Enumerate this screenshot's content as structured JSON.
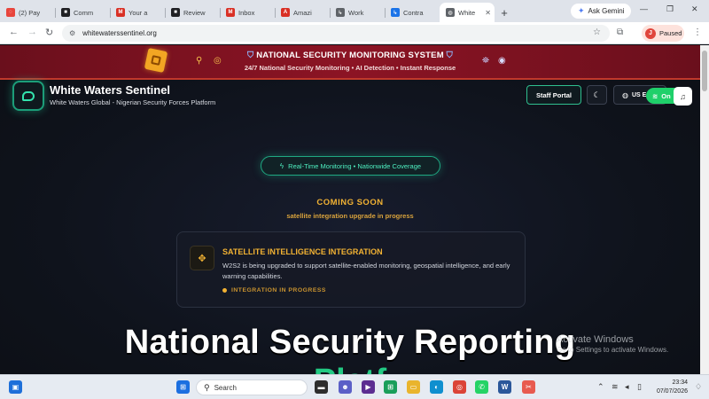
{
  "browser": {
    "tabs": [
      {
        "title": "(2) Pay",
        "color": "#e8453c",
        "glyph": "◌"
      },
      {
        "title": "Comm",
        "color": "#202124",
        "glyph": "■"
      },
      {
        "title": "Your a",
        "color": "#d93025",
        "glyph": "M"
      },
      {
        "title": "Review",
        "color": "#202124",
        "glyph": "■"
      },
      {
        "title": "Inbox",
        "color": "#d93025",
        "glyph": "M"
      },
      {
        "title": "Amazi",
        "color": "#d93025",
        "glyph": "A"
      },
      {
        "title": "Work",
        "color": "#5f6368",
        "glyph": "↳"
      },
      {
        "title": "Contra",
        "color": "#1a73e8",
        "glyph": "↳"
      },
      {
        "title": "White",
        "color": "#5f6368",
        "glyph": "◍"
      }
    ],
    "new_tab": "+",
    "ask_gemini": "Ask Gemini",
    "url": "whitewaterssentinel.org",
    "profile_initial": "J",
    "profile_status": "Paused"
  },
  "banner": {
    "title": "NATIONAL SECURITY MONITORING SYSTEM",
    "subtitle": "24/7 National Security Monitoring • AI Detection • Instant Response"
  },
  "header": {
    "brand_title": "White Waters Sentinel",
    "brand_subtitle": "White Waters Global - Nigerian Security Forces Platform",
    "staff_portal": "Staff Portal",
    "language": "US E",
    "online": "On"
  },
  "hero_section": {
    "pill": "Real-Time Monitoring • Nationwide Coverage",
    "coming_soon": "COMING SOON",
    "coming_soon_sub": "satellite integration upgrade in progress",
    "card": {
      "title": "SATELLITE INTELLIGENCE INTEGRATION",
      "text": "W2S2 is being upgraded to support satellite-enabled monitoring, geospatial intelligence, and early warning capabilities.",
      "status": "INTEGRATION IN PROGRESS"
    },
    "headline": "National Security Reporting",
    "headline_2": "Platf"
  },
  "watermark": {
    "line1": "Activate Windows",
    "line2": "Go to Settings to activate Windows."
  },
  "taskbar": {
    "search": "Search",
    "time": "23:34",
    "date": "07/07/2026"
  },
  "colors": {
    "accent_green": "#1fc08e",
    "accent_gold": "#f2b233",
    "banner_red": "#8c1424"
  }
}
